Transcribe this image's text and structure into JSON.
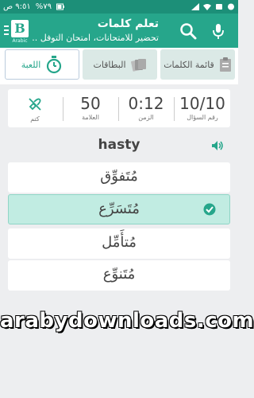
{
  "status_bar": {
    "time": "٩:٥١ ص",
    "battery": "%٧٩"
  },
  "toolbar": {
    "logo_letter": "B",
    "logo_sub": "Arabic",
    "title": "تعلم كلمات",
    "subtitle": "تحضير للامتحانات، امتحان التوفل ..."
  },
  "tabs": [
    {
      "label": "قائمة الكلمات",
      "icon": "clipboard-icon"
    },
    {
      "label": "البطاقات",
      "icon": "cards-icon"
    },
    {
      "label": "اللعبة",
      "icon": "stopwatch-icon"
    }
  ],
  "stats": {
    "question_value": "10/10",
    "question_label": "رقم السؤال",
    "time_value": "0:12",
    "time_label": "الزمن",
    "score_value": "50",
    "score_label": "العلامة",
    "mute_label": "كتم"
  },
  "quiz": {
    "word": "hasty",
    "options": [
      "مُتَفوِّق",
      "مُتَسَرِّع",
      "مُتأَمِّل",
      "مُتَنوِّع"
    ],
    "selected_index": 1
  },
  "watermark": "arabydownloads.com",
  "colors": {
    "primary": "#26a68b",
    "status_bar": "#1c8f78",
    "selected_option": "#c1ece2"
  }
}
